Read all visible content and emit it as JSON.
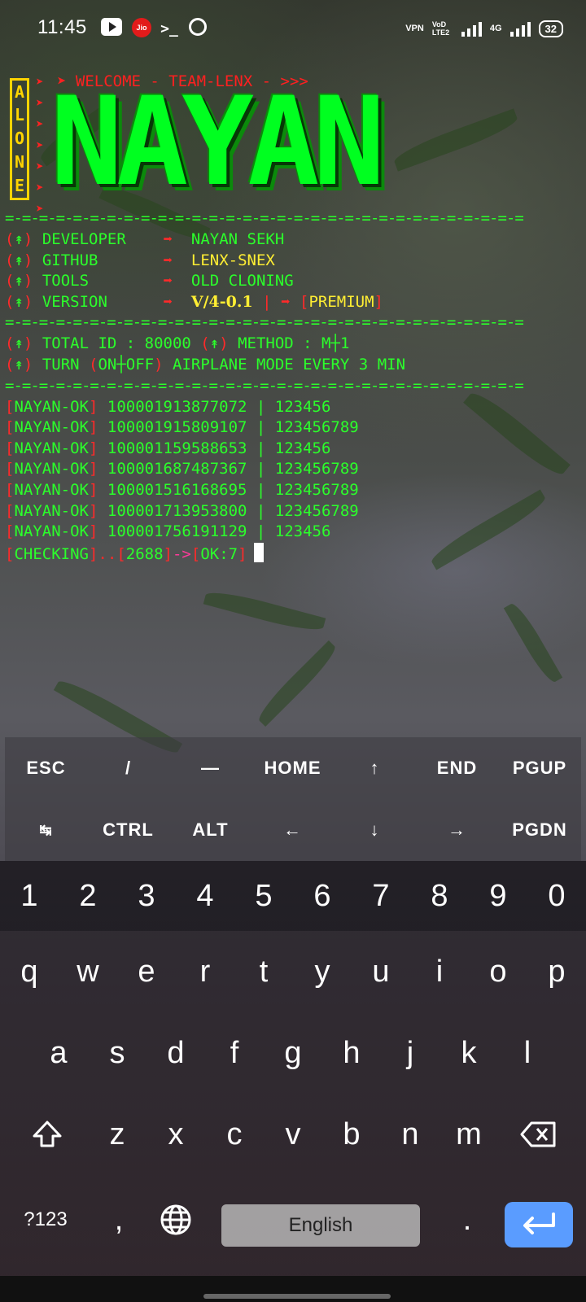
{
  "status_bar": {
    "time": "11:45",
    "left_icons": [
      "youtube-icon",
      "jio-icon",
      "terminal-icon",
      "hotspot-icon"
    ],
    "jio_label": "Jio",
    "vpn": "VPN",
    "volte": "VoD LTE2",
    "network": "4G",
    "battery": "32"
  },
  "terminal": {
    "welcome": "➤ WELCOME - TEAM-LENX - >>>",
    "alone": [
      "A",
      "L",
      "O",
      "N",
      "E"
    ],
    "logo": "NAYAN",
    "divider": "=-=-=-=-=-=-=-=-=-=-=-=-=-=-=-=-=-=-=-=-=-=-=-=-=-=-=-=-=-=-=-",
    "info": [
      {
        "label": "DEVELOPER",
        "value": "NAYAN SEKH"
      },
      {
        "label": "GITHUB",
        "value": "LENX-SNEX"
      },
      {
        "label": "TOOLS",
        "value": "OLD CLONING"
      },
      {
        "label": "VERSION",
        "value": "V/4-0.1",
        "extra": "PREMIUM"
      }
    ],
    "total_id": "TOTAL ID : 80000",
    "method": "METHOD : M┼1",
    "turn": "TURN",
    "on_off": "ON┼OFF",
    "airplane": "AIRPLANE MODE EVERY 3 MIN",
    "ok_tag": "NAYAN-OK",
    "results": [
      {
        "id": "100001913877072",
        "pass": "123456"
      },
      {
        "id": "100001915809107",
        "pass": "123456789"
      },
      {
        "id": "100001159588653",
        "pass": "123456"
      },
      {
        "id": "100001687487367",
        "pass": "123456789"
      },
      {
        "id": "100001516168695",
        "pass": "123456789"
      },
      {
        "id": "100001713953800",
        "pass": "123456789"
      },
      {
        "id": "100001756191129",
        "pass": "123456"
      }
    ],
    "checking": "CHECKING",
    "checked_count": "2688",
    "ok_count": "OK:7"
  },
  "extra_keys": {
    "row1": [
      "ESC",
      "/",
      "—",
      "HOME",
      "↑",
      "END",
      "PGUP"
    ],
    "row2": [
      "↹",
      "CTRL",
      "ALT",
      "←",
      "↓",
      "→",
      "PGDN"
    ]
  },
  "keyboard": {
    "numbers": [
      "1",
      "2",
      "3",
      "4",
      "5",
      "6",
      "7",
      "8",
      "9",
      "0"
    ],
    "row1": [
      "q",
      "w",
      "e",
      "r",
      "t",
      "y",
      "u",
      "i",
      "o",
      "p"
    ],
    "row2": [
      "a",
      "s",
      "d",
      "f",
      "g",
      "h",
      "j",
      "k",
      "l"
    ],
    "row3": [
      "z",
      "x",
      "c",
      "v",
      "b",
      "n",
      "m"
    ],
    "symbols_key": "?123",
    "comma": ",",
    "period": ".",
    "space_label": "English",
    "enter_color": "#5a9cff"
  }
}
